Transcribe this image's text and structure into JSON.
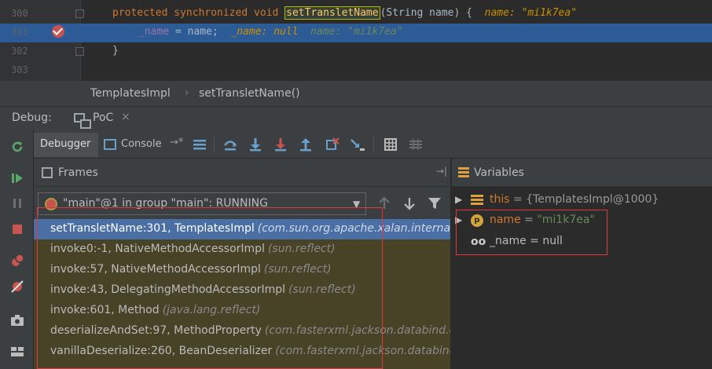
{
  "editor": {
    "lines": [
      {
        "number": "300",
        "keyword": "protected synchronized void ",
        "method": "setTransletName",
        "rest": "(String name) {",
        "inline": "name: \"mi1k7ea\""
      },
      {
        "number": "301",
        "field": "_name",
        "rest": " = name;",
        "inline_null": "_name: null",
        "inline_str": "name: \"mi1k7ea\""
      },
      {
        "number": "302",
        "rest": "}"
      },
      {
        "number": "303"
      }
    ]
  },
  "breadcrumb": {
    "class_name": "TemplatesImpl",
    "method_name": "setTransletName()"
  },
  "debug": {
    "title": "Debug:",
    "session": "PoC",
    "session_close": "×"
  },
  "toolbar": {
    "debugger_tab": "Debugger",
    "console_tab": "Console",
    "console_arrow": "→*"
  },
  "frames": {
    "title": "Frames",
    "pin": "→|",
    "thread": "\"main\"@1 in group \"main\": RUNNING",
    "items": [
      {
        "name": "setTransletName:301, TemplatesImpl",
        "pkg": "(com.sun.org.apache.xalan.internal.xsltc.trax)"
      },
      {
        "name": "invoke0:-1, NativeMethodAccessorImpl",
        "pkg": "(sun.reflect)"
      },
      {
        "name": "invoke:57, NativeMethodAccessorImpl",
        "pkg": "(sun.reflect)"
      },
      {
        "name": "invoke:43, DelegatingMethodAccessorImpl",
        "pkg": "(sun.reflect)"
      },
      {
        "name": "invoke:601, Method",
        "pkg": "(java.lang.reflect)"
      },
      {
        "name": "deserializeAndSet:97, MethodProperty",
        "pkg": "(com.fasterxml.jackson.databind.deser.impl)"
      },
      {
        "name": "vanillaDeserialize:260, BeanDeserializer",
        "pkg": "(com.fasterxml.jackson.databind.deser)"
      }
    ]
  },
  "variables": {
    "title": "Variables",
    "items": [
      {
        "name": "this",
        "eq": " = ",
        "value": "{TemplatesImpl@1000}"
      },
      {
        "name": "name",
        "eq": " = ",
        "value": "\"mi1k7ea\""
      },
      {
        "name": "_name",
        "eq": " = ",
        "value": "null"
      }
    ]
  },
  "colors": {
    "accent_selection": "#4a6fa5",
    "current_line": "#2d5b96",
    "highlight_box": "#e0383c",
    "breakpoint": "#c75450"
  }
}
